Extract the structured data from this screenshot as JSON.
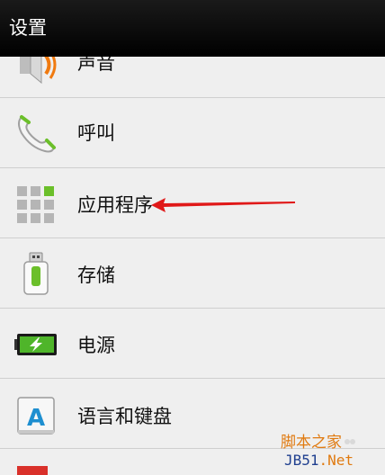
{
  "titlebar": {
    "title": "设置"
  },
  "settings_items": [
    {
      "label": "声音",
      "icon": "speaker-icon"
    },
    {
      "label": "呼叫",
      "icon": "phone-icon"
    },
    {
      "label": "应用程序",
      "icon": "apps-grid-icon"
    },
    {
      "label": "存储",
      "icon": "usb-storage-icon"
    },
    {
      "label": "电源",
      "icon": "battery-icon"
    },
    {
      "label": "语言和键盘",
      "icon": "keyboard-letter-icon"
    }
  ],
  "watermark": {
    "line1": "脚本之家",
    "line2_a": "JB51",
    "line2_b": ".Net"
  },
  "colors": {
    "accent_green": "#6bbf2a",
    "arrow_red": "#e01818",
    "titlebar": "#000000"
  }
}
